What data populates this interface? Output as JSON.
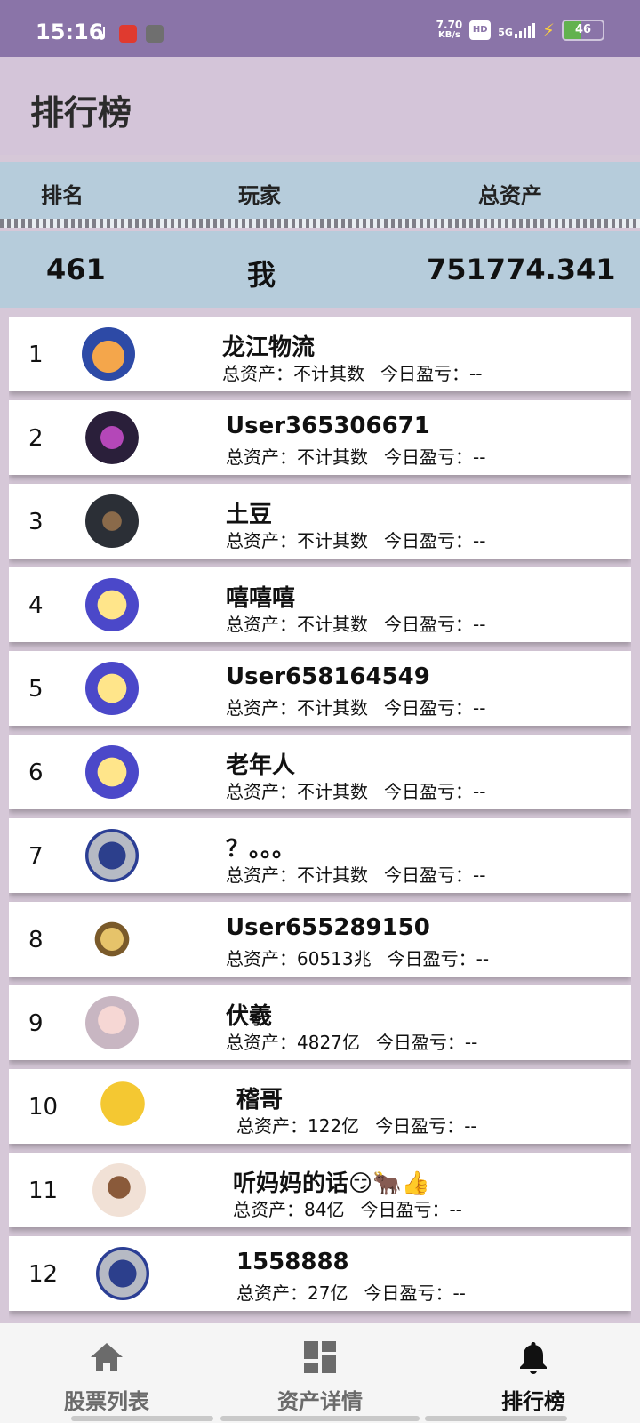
{
  "status": {
    "time": "15:16",
    "speed_value": "7.70",
    "speed_unit": "KB/s",
    "hd": "HD",
    "network": "5G",
    "battery": "46",
    "battery_level": 0.46
  },
  "app": {
    "title": "排行榜"
  },
  "table": {
    "headers": {
      "rank": "排名",
      "player": "玩家",
      "assets": "总资产"
    }
  },
  "me": {
    "rank": "461",
    "name": "我",
    "assets": "751774.341"
  },
  "labels": {
    "assets_prefix": "总资产：",
    "pl_prefix": "今日盈亏："
  },
  "rows": [
    {
      "rank": "1",
      "name": "龙江物流",
      "assets": "不计其数",
      "pl": "--",
      "avatar": "shiba-avatar-icon"
    },
    {
      "rank": "2",
      "name": "User365306671",
      "assets": "不计其数",
      "pl": "--",
      "avatar": "dark-anime-avatar-icon"
    },
    {
      "rank": "3",
      "name": "土豆",
      "assets": "不计其数",
      "pl": "--",
      "avatar": "armored-hero-avatar-icon"
    },
    {
      "rank": "4",
      "name": "嘻嘻嘻",
      "assets": "不计其数",
      "pl": "--",
      "avatar": "blonde-cartoon-avatar-icon"
    },
    {
      "rank": "5",
      "name": "User658164549",
      "assets": "不计其数",
      "pl": "--",
      "avatar": "blonde-cartoon-avatar-icon"
    },
    {
      "rank": "6",
      "name": "老年人",
      "assets": "不计其数",
      "pl": "--",
      "avatar": "blonde-cartoon-avatar-icon"
    },
    {
      "rank": "7",
      "name": "？。。。",
      "assets": "不计其数",
      "pl": "--",
      "avatar": "robot-avatar-icon"
    },
    {
      "rank": "8",
      "name": "User655289150",
      "assets": "60513兆",
      "pl": "--",
      "avatar": "crest-avatar-icon"
    },
    {
      "rank": "9",
      "name": "伏羲",
      "assets": "4827亿",
      "pl": "--",
      "avatar": "anime-girl-avatar-icon"
    },
    {
      "rank": "10",
      "name": "稽哥",
      "assets": "122亿",
      "pl": "--",
      "avatar": "emoji-face-avatar-icon"
    },
    {
      "rank": "11",
      "name": "听妈妈的话😏🐂👍",
      "assets": "84亿",
      "pl": "--",
      "avatar": "anime-boy-avatar-icon"
    },
    {
      "rank": "12",
      "name": "1558888",
      "assets": "27亿",
      "pl": "--",
      "avatar": "robot-avatar-icon"
    }
  ],
  "nav": [
    {
      "label": "股票列表",
      "icon": "home-icon",
      "active": false
    },
    {
      "label": "资产详情",
      "icon": "dashboard-icon",
      "active": false
    },
    {
      "label": "排行榜",
      "icon": "bell-icon",
      "active": true
    }
  ],
  "colors": {
    "accent_header": "#b6ccdb",
    "statusbar": "#8a74a8",
    "appbar": "#d4c5d9",
    "nav_inactive": "#6b6b6b",
    "nav_active": "#111111"
  }
}
